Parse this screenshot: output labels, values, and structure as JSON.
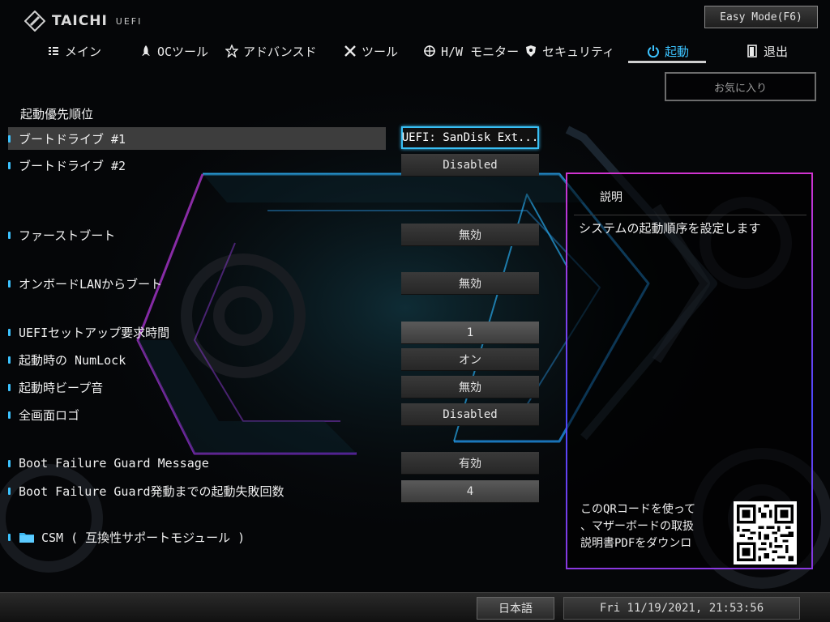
{
  "header": {
    "logo_text": "TAICHI",
    "logo_sub": "UEFI",
    "easy_mode_label": "Easy Mode(F6)"
  },
  "tabs": [
    {
      "label": "メイン",
      "icon": "list-icon",
      "active": false
    },
    {
      "label": "OCツール",
      "icon": "rocket-icon",
      "active": false
    },
    {
      "label": "アドバンスド",
      "icon": "star-icon",
      "active": false
    },
    {
      "label": "ツール",
      "icon": "tools-icon",
      "active": false
    },
    {
      "label": "H/W モニター",
      "icon": "crosshair-icon",
      "active": false
    },
    {
      "label": "セキュリティ",
      "icon": "shield-icon",
      "active": false
    },
    {
      "label": "起動",
      "icon": "power-icon",
      "active": true
    },
    {
      "label": "退出",
      "icon": "exit-door-icon",
      "active": false
    }
  ],
  "favorites_label": "お気に入り",
  "section_title": "起動優先順位",
  "settings": [
    {
      "label": "ブートドライブ #1",
      "value": "UEFI: SanDisk Ext..."
    },
    {
      "label": "ブートドライブ #2",
      "value": "Disabled"
    },
    {
      "label": "ファーストブート",
      "value": "無効"
    },
    {
      "label": "オンボードLANからブート",
      "value": "無効"
    },
    {
      "label": "UEFIセットアップ要求時間",
      "value": "1"
    },
    {
      "label": "起動時の NumLock",
      "value": "オン"
    },
    {
      "label": "起動時ビープ音",
      "value": "無効"
    },
    {
      "label": "全画面ロゴ",
      "value": "Disabled"
    },
    {
      "label": "Boot Failure Guard Message",
      "value": "有効"
    },
    {
      "label": "Boot Failure Guard発動までの起動失敗回数",
      "value": "4"
    }
  ],
  "csm_label": "CSM ( 互換性サポートモジュール )",
  "description": {
    "title": "説明",
    "text": "システムの起動順序を設定します",
    "qr_line1": "このQRコードを使って",
    "qr_line2": "、マザーボードの取扱",
    "qr_line3": "説明書PDFをダウンロ"
  },
  "footer": {
    "language": "日本語",
    "datetime": "Fri 11/19/2021, 21:53:56"
  },
  "colors": {
    "accent": "#3cc3ff",
    "panel_border_top": "#d033d0",
    "panel_border_mid": "#4a48ff"
  }
}
